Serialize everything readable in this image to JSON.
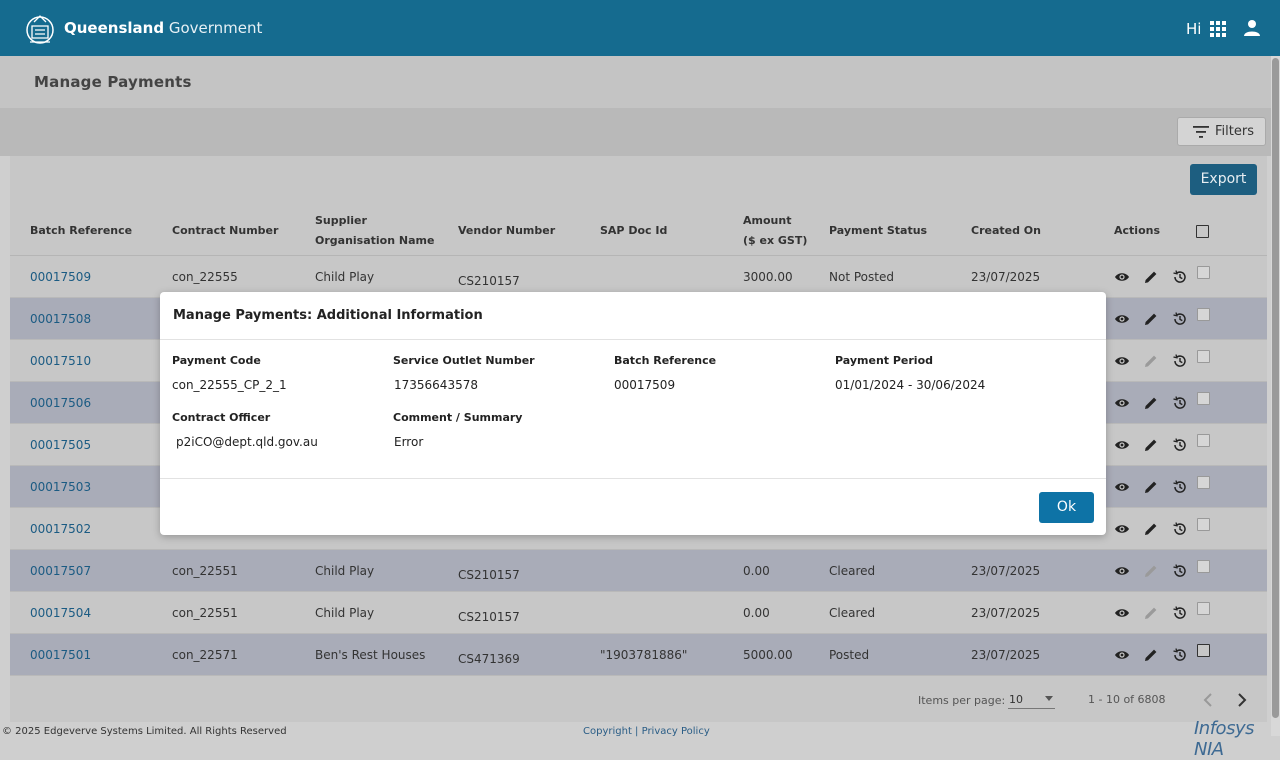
{
  "header": {
    "brand_bold": "Queensland",
    "brand_rest": " Government",
    "greeting": "Hi",
    "apps_icon": "apps-grid-icon",
    "user_icon": "user-icon",
    "color": "#156b8f"
  },
  "page": {
    "title": "Manage Payments",
    "filters_label": "Filters",
    "export_label": "Export"
  },
  "table": {
    "headers": {
      "batch_reference": "Batch Reference",
      "contract_number": "Contract Number",
      "supplier_line1": "Supplier",
      "supplier_line2": "Organisation Name",
      "vendor_number": "Vendor Number",
      "sap_doc_id": "SAP Doc Id",
      "amount_line1": "Amount",
      "amount_line2": "($ ex GST)",
      "payment_status": "Payment Status",
      "created_on": "Created On",
      "actions": "Actions"
    },
    "rows": [
      {
        "batch": "00017509",
        "contract": "con_22555",
        "supplier": "Child Play",
        "vendor": "CS210157",
        "sap": "",
        "amount": "3000.00",
        "status": "Not Posted",
        "created": "23/07/2025",
        "edit_enabled": true
      },
      {
        "batch": "00017508",
        "contract": "",
        "supplier": "",
        "vendor": "",
        "sap": "",
        "amount": "",
        "status": "",
        "created": "",
        "edit_enabled": true
      },
      {
        "batch": "00017510",
        "contract": "",
        "supplier": "",
        "vendor": "",
        "sap": "",
        "amount": "",
        "status": "",
        "created": "",
        "edit_enabled": false
      },
      {
        "batch": "00017506",
        "contract": "",
        "supplier": "",
        "vendor": "",
        "sap": "",
        "amount": "",
        "status": "",
        "created": "",
        "edit_enabled": true
      },
      {
        "batch": "00017505",
        "contract": "",
        "supplier": "",
        "vendor": "",
        "sap": "",
        "amount": "",
        "status": "",
        "created": "",
        "edit_enabled": true
      },
      {
        "batch": "00017503",
        "contract": "",
        "supplier": "",
        "vendor": "",
        "sap": "",
        "amount": "",
        "status": "",
        "created": "",
        "edit_enabled": true
      },
      {
        "batch": "00017502",
        "contract": "",
        "supplier": "",
        "vendor": "",
        "sap": "",
        "amount": "",
        "status": "",
        "created": "",
        "edit_enabled": true
      },
      {
        "batch": "00017507",
        "contract": "con_22551",
        "supplier": "Child Play",
        "vendor": "CS210157",
        "sap": "",
        "amount": "0.00",
        "status": "Cleared",
        "created": "23/07/2025",
        "edit_enabled": false
      },
      {
        "batch": "00017504",
        "contract": "con_22551",
        "supplier": "Child Play",
        "vendor": "CS210157",
        "sap": "",
        "amount": "0.00",
        "status": "Cleared",
        "created": "23/07/2025",
        "edit_enabled": false
      },
      {
        "batch": "00017501",
        "contract": "con_22571",
        "supplier": "Ben's Rest Houses",
        "vendor": "CS471369",
        "sap": "\"1903781886\"",
        "amount": "5000.00",
        "status": "Posted",
        "created": "23/07/2025",
        "edit_enabled": true
      }
    ]
  },
  "pagination": {
    "items_per_page_label": "Items per page:",
    "items_per_page_value": "10",
    "range": "1 - 10 of 6808"
  },
  "footer": {
    "copyright": "© 2025 Edgeverve Systems Limited. All Rights Reserved",
    "links": "Copyright | Privacy Policy",
    "brand": "Infosys NIA"
  },
  "modal": {
    "title": "Manage Payments: Additional Information",
    "fields": [
      {
        "label": "Payment Code",
        "value": "con_22555_CP_2_1"
      },
      {
        "label": "Service Outlet Number",
        "value": "17356643578"
      },
      {
        "label": "Batch Reference",
        "value": "00017509"
      },
      {
        "label": "Payment Period",
        "value": "01/01/2024 - 30/06/2024"
      },
      {
        "label": "Contract Officer",
        "value": "p2iCO@dept.qld.gov.au"
      },
      {
        "label": "Comment / Summary",
        "value": "Error"
      }
    ],
    "ok_label": "Ok"
  }
}
